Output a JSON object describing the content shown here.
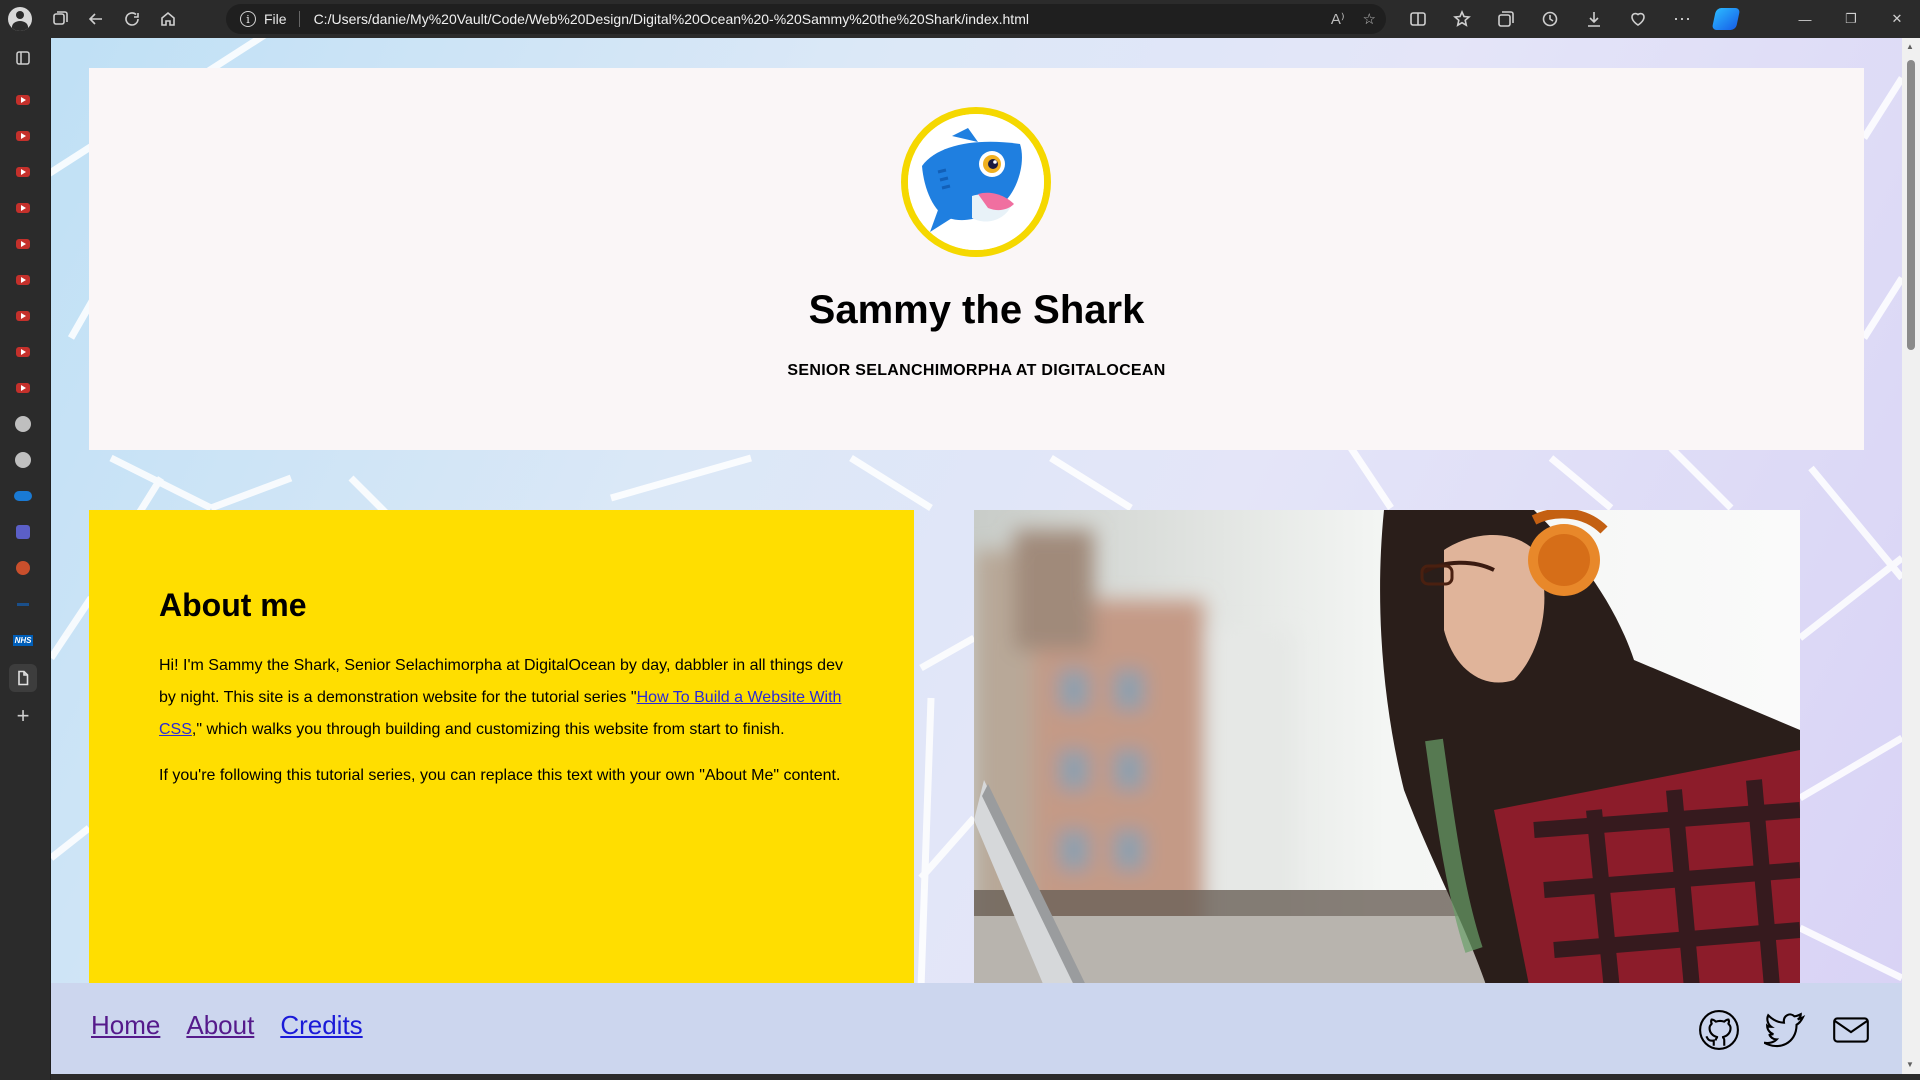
{
  "browser": {
    "scheme_label": "File",
    "url": "C:/Users/danie/My%20Vault/Code/Web%20Design/Digital%20Ocean%20-%20Sammy%20the%20Shark/index.html",
    "read_aloud_label": "A⁾"
  },
  "header": {
    "title": "Sammy the Shark",
    "subtitle": "SENIOR SELANCHIMORPHA AT DIGITALOCEAN"
  },
  "about": {
    "heading": "About me",
    "para1_before": "Hi! I'm Sammy the Shark, Senior Selachimorpha at DigitalOcean by day, dabbler in all things dev by night. This site is a demonstration website for the tutorial series \"",
    "para1_link": "How To Build a Website With CSS",
    "para1_after": ",\" which walks you through building and customizing this website from start to finish.",
    "para2": "If you're following this tutorial series, you can replace this text with your own \"About Me\" content."
  },
  "footer": {
    "nav": [
      "Home",
      "About",
      "Credits"
    ],
    "social_icons": [
      "github-icon",
      "twitter-icon",
      "email-icon"
    ]
  },
  "colors": {
    "accent_yellow": "#ffde00",
    "header_bg": "#faf6f7",
    "footer_bg": "#ccd6ee",
    "link_visited": "#551a8b",
    "link": "#1a1ad8"
  }
}
